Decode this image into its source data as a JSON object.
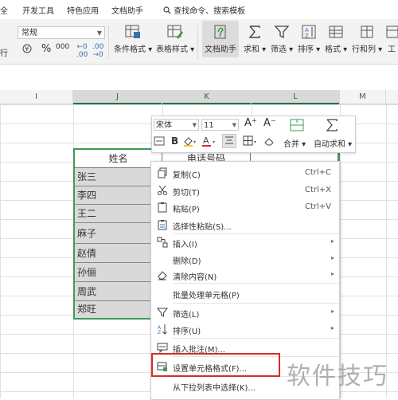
{
  "ribbon_tabs": [
    "全",
    "开发工具",
    "特色应用",
    "文档助手"
  ],
  "search": {
    "label": "查找命令、搜索模板"
  },
  "ribbon": {
    "left_label": "行",
    "style_value": "常规",
    "percent_symbol": "%",
    "comma_symbol": "000",
    "buttons": [
      "条件格式",
      "表格样式",
      "文档助手",
      "求和",
      "筛选",
      "排序",
      "格式",
      "行和列",
      "工"
    ]
  },
  "columns": [
    "I",
    "J",
    "K",
    "L",
    "M"
  ],
  "table": {
    "headers": [
      "姓名",
      "电话号码"
    ],
    "names": [
      "张三",
      "李四",
      "王二",
      "麻子",
      "赵倩",
      "孙俪",
      "周武",
      "郑旺"
    ]
  },
  "mini_toolbar": {
    "font": "宋体",
    "size": "11",
    "grow": "A⁺",
    "shrink": "A⁻",
    "bold": "B",
    "merge": "合并",
    "autosum": "自动求和"
  },
  "context_menu": [
    {
      "label": "复制(C)",
      "shortcut": "Ctrl+C",
      "icon": "copy-icon"
    },
    {
      "label": "剪切(T)",
      "shortcut": "Ctrl+X",
      "icon": "scissors-icon"
    },
    {
      "label": "粘贴(P)",
      "shortcut": "Ctrl+V",
      "icon": "paste-icon"
    },
    {
      "label": "选择性粘贴(S)...",
      "shortcut": "",
      "icon": "paste-special-icon"
    },
    {
      "label": "插入(I)",
      "shortcut": "",
      "icon": "insert-icon",
      "submenu": true
    },
    {
      "label": "删除(D)",
      "shortcut": "",
      "icon": "",
      "submenu": true
    },
    {
      "label": "清除内容(N)",
      "shortcut": "",
      "icon": "eraser-icon",
      "submenu": true
    },
    {
      "label": "批量处理单元格(P)",
      "shortcut": "",
      "icon": ""
    },
    {
      "label": "筛选(L)",
      "shortcut": "",
      "icon": "filter-icon",
      "submenu": true
    },
    {
      "label": "排序(U)",
      "shortcut": "",
      "icon": "sort-icon",
      "submenu": true
    },
    {
      "label": "插入批注(M)...",
      "shortcut": "",
      "icon": "comment-icon"
    },
    {
      "label": "设置单元格格式(F)...",
      "shortcut": "",
      "icon": "format-cells-icon"
    },
    {
      "label": "从下拉列表中选择(K)...",
      "shortcut": "",
      "icon": ""
    }
  ],
  "watermark": "软件技巧",
  "colors": {
    "accent_green": "#217346",
    "selection_border": "#3f9a55",
    "highlight_red": "#d62b2b",
    "cell_fill": "#d9d9d9"
  }
}
